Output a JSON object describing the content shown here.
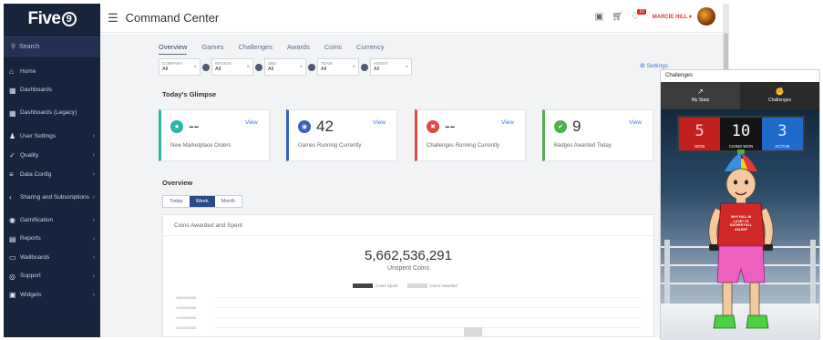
{
  "sidebar": {
    "logo": "Five",
    "logo_mark": "9",
    "search_placeholder": "Search",
    "items": [
      {
        "label": "Home",
        "icon": "home-icon",
        "chevron": false
      },
      {
        "label": "Dashboards",
        "icon": "dashboard-icon",
        "chevron": false
      },
      {
        "label": "Dashboards (Legacy)",
        "icon": "dashboard-legacy-icon",
        "chevron": false
      },
      {
        "label": "User Settings",
        "icon": "user-icon",
        "chevron": true
      },
      {
        "label": "Quality",
        "icon": "check-icon",
        "chevron": true
      },
      {
        "label": "Data Config",
        "icon": "data-config-icon",
        "chevron": true
      },
      {
        "label": "Sharing and Subscriptions",
        "icon": "share-icon",
        "chevron": true
      },
      {
        "label": "Gamification",
        "icon": "gamepad-icon",
        "chevron": true
      },
      {
        "label": "Reports",
        "icon": "reports-icon",
        "chevron": true
      },
      {
        "label": "Wallboards",
        "icon": "wallboard-icon",
        "chevron": true
      },
      {
        "label": "Support",
        "icon": "support-icon",
        "chevron": true
      },
      {
        "label": "Widgets",
        "icon": "widgets-icon",
        "chevron": true
      }
    ]
  },
  "header": {
    "title": "Command Center",
    "notification_count": "10",
    "user_name": "MARCIE HILL"
  },
  "tabs": [
    "Overview",
    "Games",
    "Challenges",
    "Awards",
    "Coins",
    "Currency"
  ],
  "filters": [
    {
      "label": "COMPANY",
      "value": "All"
    },
    {
      "label": "REGION",
      "value": "All"
    },
    {
      "label": "SBU",
      "value": "All"
    },
    {
      "label": "TEAM",
      "value": "All"
    },
    {
      "label": "AGENT",
      "value": "All"
    }
  ],
  "settings_label": "Settings",
  "glimpse": {
    "title": "Today's Glimpse",
    "cards": [
      {
        "value": "--",
        "caption": "New Marketplace Orders",
        "link": "View",
        "color": "#2bb3a3",
        "icon": "cart-icon"
      },
      {
        "value": "42",
        "caption": "Games Running Currently",
        "link": "View",
        "color": "#3a5fc0",
        "icon": "gamepad-icon"
      },
      {
        "value": "--",
        "caption": "Challenges Running Currently",
        "link": "View",
        "color": "#e04848",
        "icon": "challenge-icon"
      },
      {
        "value": "9",
        "caption": "Badges Awarded Today",
        "link": "View",
        "color": "#4cae4c",
        "icon": "badge-icon"
      }
    ]
  },
  "overview": {
    "title": "Overview",
    "periods": [
      "Today",
      "Week",
      "Month"
    ],
    "active_period": "Week",
    "panel_title": "Coins Awarded and Spent",
    "total": "5,662,536,291",
    "total_caption": "Unspent Coins",
    "legend": [
      {
        "name": "Coins Spent",
        "color": "#444444"
      },
      {
        "name": "Coins Awarded",
        "color": "#d9d9d9"
      }
    ],
    "y_ticks": [
      "1600000000",
      "1400000000",
      "1200000000",
      "1000000000"
    ]
  },
  "chart_data": {
    "type": "bar",
    "categories": [
      ""
    ],
    "series": [
      {
        "name": "Coins Spent",
        "values": [
          0
        ]
      },
      {
        "name": "Coins Awarded",
        "values": [
          1000000000
        ]
      }
    ],
    "title": "Coins Awarded and Spent",
    "ylim": [
      900000000,
      1600000000
    ],
    "legend": "top"
  },
  "widget": {
    "title": "Challenges",
    "tabs": [
      {
        "label": "My Stats",
        "icon": "chart-icon"
      },
      {
        "label": "Challenges",
        "icon": "boxing-glove-icon"
      }
    ],
    "scores": [
      {
        "label": "WON",
        "value": "5"
      },
      {
        "label": "COINS WON",
        "value": "10"
      },
      {
        "label": "ACTIVE",
        "value": "3"
      }
    ],
    "shirt_text": "WHY FALL IN LOVE? I'D RATHER FALL ASLEEP"
  }
}
